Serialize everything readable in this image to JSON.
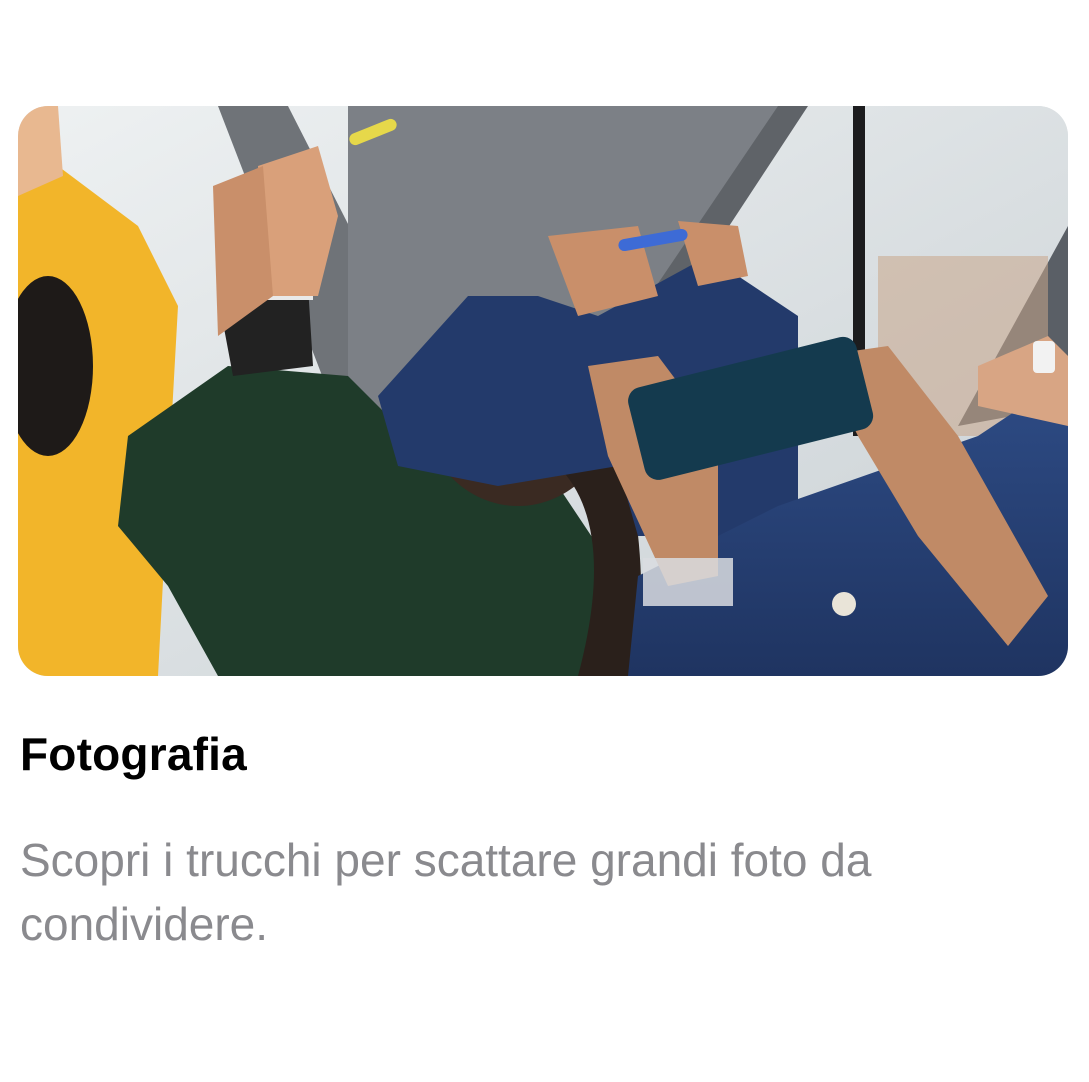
{
  "card": {
    "image_alt": "People taking photos with their phones",
    "title": "Fotografia",
    "description": "Scopri i trucchi per scattare grandi foto da condividere."
  },
  "colors": {
    "title": "#000000",
    "description": "#8a8a8e",
    "background": "#ffffff"
  }
}
